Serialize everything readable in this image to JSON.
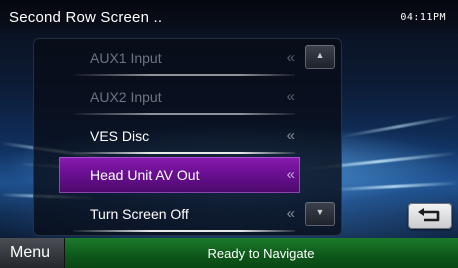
{
  "header": {
    "title": "Second Row Screen ..",
    "clock": "04:11PM"
  },
  "list": {
    "items": [
      {
        "label": "AUX1 Input",
        "state": "disabled",
        "chevron": "«"
      },
      {
        "label": "AUX2 Input",
        "state": "disabled",
        "chevron": "«"
      },
      {
        "label": "VES Disc",
        "state": "normal",
        "chevron": "«"
      },
      {
        "label": "Head Unit AV Out",
        "state": "selected",
        "chevron": "«"
      },
      {
        "label": "Turn Screen Off",
        "state": "normal",
        "chevron": "«"
      }
    ],
    "selected_color": "#7a14a0",
    "scroll_up_glyph": "▲",
    "scroll_down_glyph": "▼"
  },
  "back_button": {
    "icon": "back-return-arrow-icon"
  },
  "footer": {
    "menu_label": "Menu",
    "status_text": "Ready to Navigate",
    "accent_color": "#1c7a2a"
  }
}
